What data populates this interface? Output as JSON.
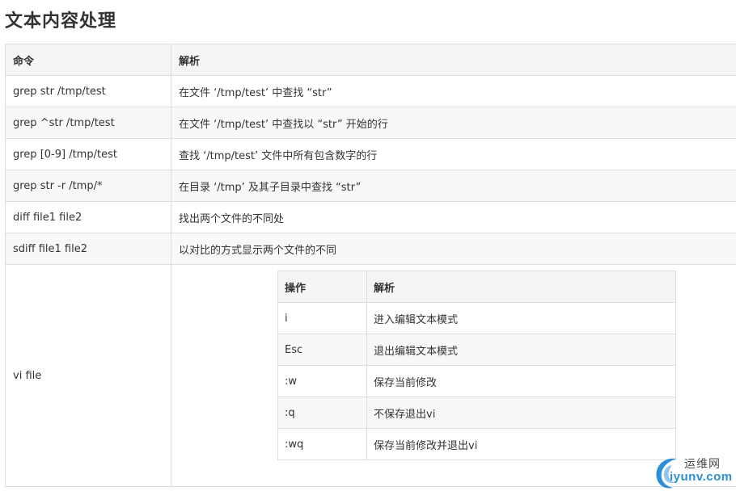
{
  "title": "文本内容处理",
  "main_table": {
    "headers": [
      "命令",
      "解析"
    ],
    "rows": [
      {
        "command": "grep str /tmp/test",
        "description": "在文件 ‘/tmp/test’ 中查找 “str”"
      },
      {
        "command": "grep ^str /tmp/test",
        "description": "在文件 ‘/tmp/test’ 中查找以 “str” 开始的行"
      },
      {
        "command": "grep [0-9] /tmp/test",
        "description": "查找 ‘/tmp/test’ 文件中所有包含数字的行"
      },
      {
        "command": "grep str -r /tmp/*",
        "description": "在目录 ‘/tmp’ 及其子目录中查找 “str”"
      },
      {
        "command": "diff file1 file2",
        "description": "找出两个文件的不同处"
      },
      {
        "command": "sdiff file1 file2",
        "description": "以对比的方式显示两个文件的不同"
      }
    ],
    "vi_row": {
      "command": "vi file"
    }
  },
  "vi_table": {
    "headers": [
      "操作",
      "解析"
    ],
    "rows": [
      {
        "op": "i",
        "description": "进入编辑文本模式"
      },
      {
        "op": "Esc",
        "description": "退出编辑文本模式"
      },
      {
        "op": ":w",
        "description": "保存当前修改"
      },
      {
        "op": ":q",
        "description": "不保存退出vi"
      },
      {
        "op": ":wq",
        "description": "保存当前修改并退出vi"
      }
    ]
  },
  "watermark": {
    "name_cn": "运维网",
    "domain": "iyunv.com",
    "icon": "swirl-logo-icon"
  },
  "colors": {
    "header_bg": "#f5f5f5",
    "stripe_bg": "#f8f8f8",
    "border": "#dddddd",
    "text": "#333333",
    "logo_blue": "#2a8fd6"
  }
}
